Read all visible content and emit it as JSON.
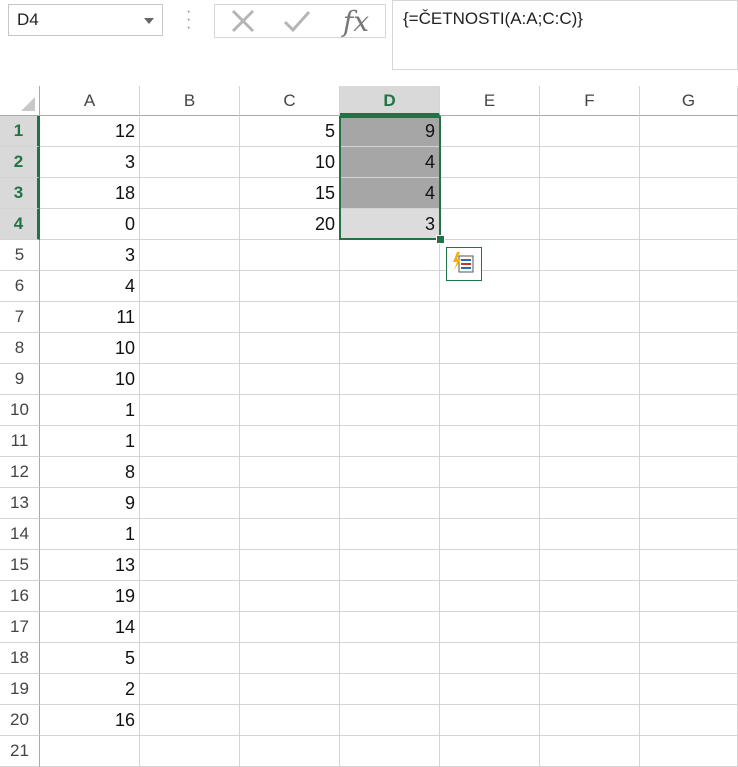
{
  "name_box": {
    "value": "D4"
  },
  "formula_bar": {
    "formula": "{=ČETNOSTI(A:A;C:C)}",
    "fx_label": "fx"
  },
  "columns": [
    "A",
    "B",
    "C",
    "D",
    "E",
    "F",
    "G"
  ],
  "selected_column": "D",
  "rows": [
    "1",
    "2",
    "3",
    "4",
    "5",
    "6",
    "7",
    "8",
    "9",
    "10",
    "11",
    "12",
    "13",
    "14",
    "15",
    "16",
    "17",
    "18",
    "19",
    "20",
    "21"
  ],
  "selected_rows": [
    "1",
    "2",
    "3",
    "4"
  ],
  "column_a": [
    "12",
    "3",
    "18",
    "0",
    "3",
    "4",
    "11",
    "10",
    "10",
    "1",
    "1",
    "8",
    "9",
    "1",
    "13",
    "19",
    "14",
    "5",
    "2",
    "16",
    ""
  ],
  "column_c": [
    "5",
    "10",
    "15",
    "20"
  ],
  "column_d": [
    "9",
    "4",
    "4",
    "3"
  ],
  "colors": {
    "accent": "#217346",
    "selection_fill": "#a6a6a6",
    "active_cell_fill": "#dcdcdc"
  },
  "icons": {
    "cancel": "close-x-icon",
    "enter": "checkmark-icon",
    "quick_analysis": "quick-analysis-icon"
  }
}
